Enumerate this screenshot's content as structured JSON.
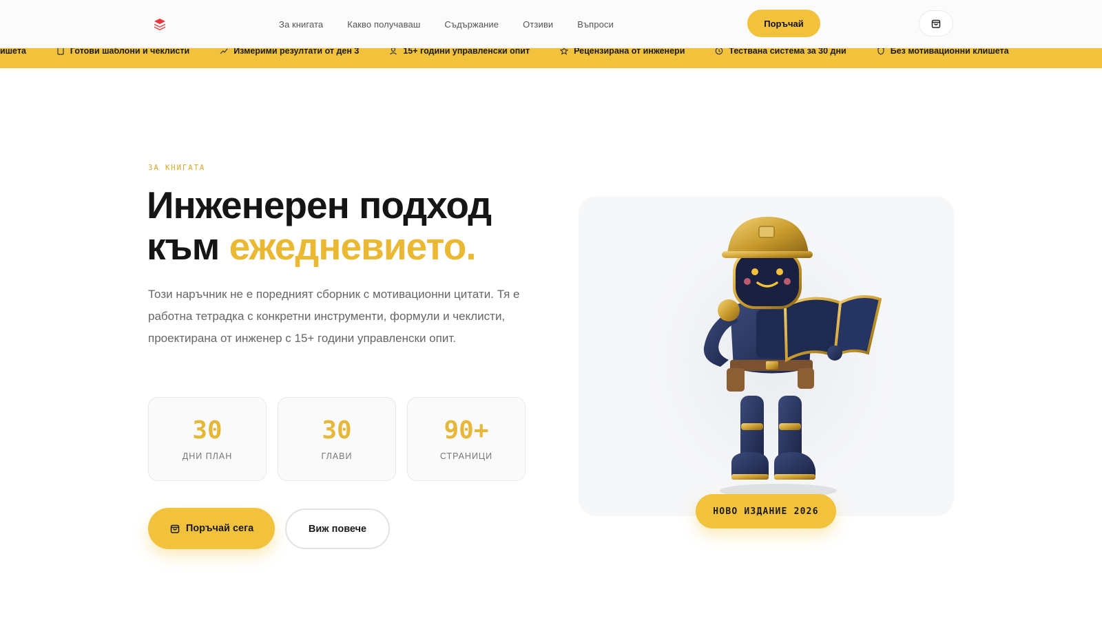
{
  "header": {
    "logo_icon": "stacked-layers-icon",
    "brand_color": "#e8383d",
    "nav": [
      "За книгата",
      "Какво получаваш",
      "Съдържание",
      "Отзиви",
      "Въпроси"
    ],
    "order_label": "Поръчай",
    "cart_icon": "shopping-bag-icon"
  },
  "ticker": {
    "items": [
      {
        "icon": "check-icon",
        "label": "лишета"
      },
      {
        "icon": "clipboard-icon",
        "label": "Готови шаблони и чеклисти"
      },
      {
        "icon": "trend-icon",
        "label": "Измерими резултати от ден 3"
      },
      {
        "icon": "user-icon",
        "label": "15+ години управленски опит"
      },
      {
        "icon": "star-icon",
        "label": "Рецензирана от инженери"
      },
      {
        "icon": "clock-icon",
        "label": "Тествана система за 30 дни"
      },
      {
        "icon": "shield-icon",
        "label": "Без мотивационни клишета"
      }
    ]
  },
  "hero": {
    "eyebrow": "ЗА КНИГАТА",
    "title_part1": "Инженерен подход",
    "title_part2": "към",
    "title_accent": "ежедневието.",
    "description": "Този наръчник не е поредният сборник с мотивационни цитати. Тя е работна тетрадка с конкретни инструменти, формули и чеклисти, проектирана от инженер с 15+ години управленски опит.",
    "stats": [
      {
        "value": "30",
        "label": "ДНИ ПЛАН"
      },
      {
        "value": "30",
        "label": "ГЛАВИ"
      },
      {
        "value": "90+",
        "label": "СТРАНИЦИ"
      }
    ],
    "cta_primary": "Поръчай сега",
    "cta_secondary": "Виж повече",
    "badge": "НОВО ИЗДАНИЕ 2026"
  },
  "colors": {
    "accent": "#f2c23d",
    "accent_text": "#ebb833"
  }
}
